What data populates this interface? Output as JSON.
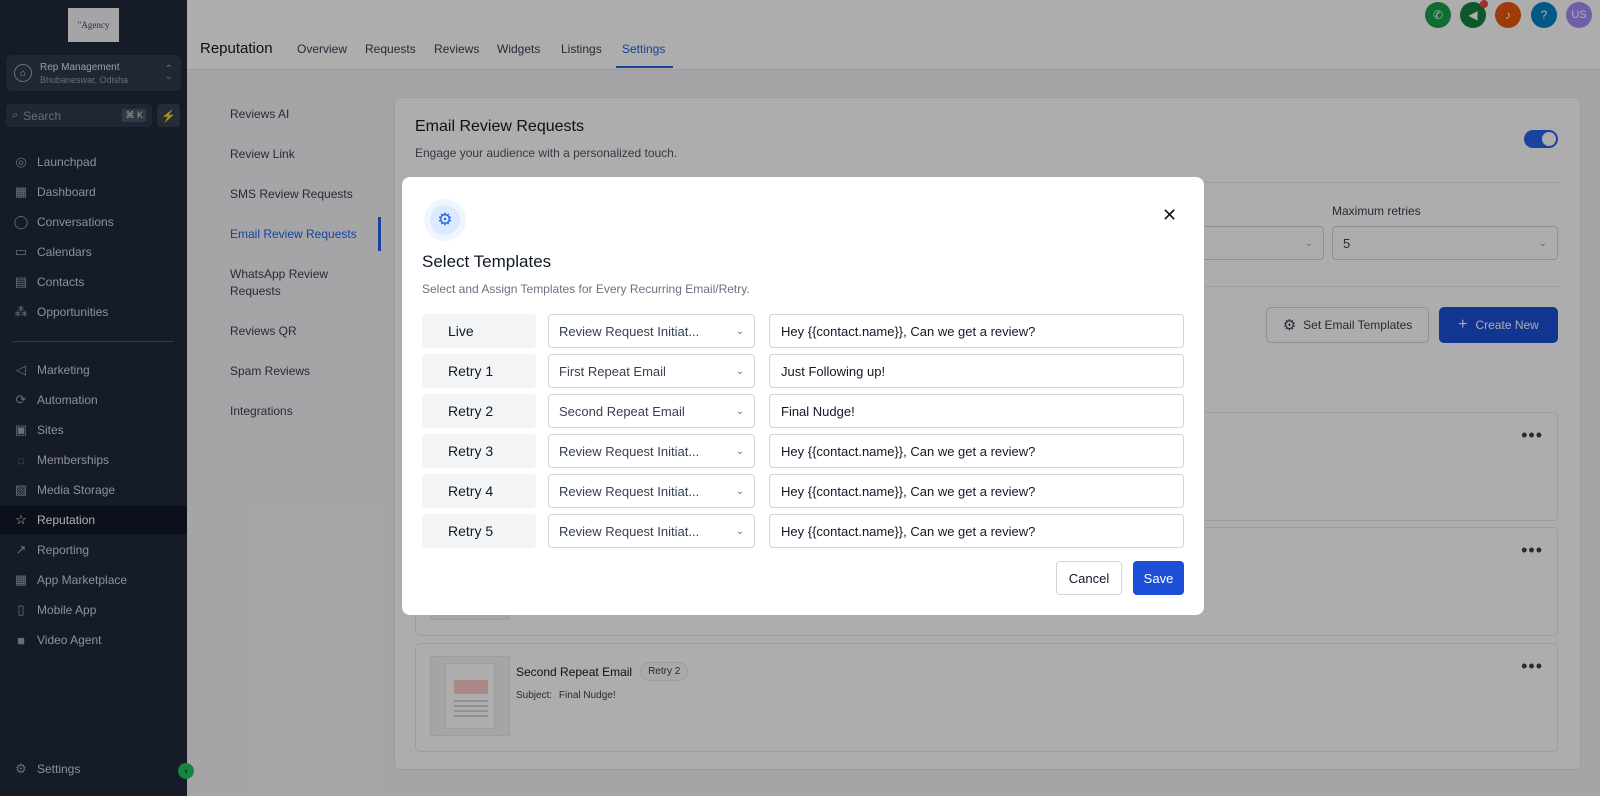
{
  "sidebar": {
    "logo": "\"Agency",
    "location": {
      "name": "Rep Management",
      "sub": "Bhubaneswar, Odisha"
    },
    "search": {
      "placeholder": "Search",
      "shortcut": "⌘ K"
    },
    "items": [
      {
        "label": "Launchpad",
        "icon": "rocket-icon"
      },
      {
        "label": "Dashboard",
        "icon": "dashboard-icon"
      },
      {
        "label": "Conversations",
        "icon": "chat-icon"
      },
      {
        "label": "Calendars",
        "icon": "calendar-icon"
      },
      {
        "label": "Contacts",
        "icon": "contacts-icon"
      },
      {
        "label": "Opportunities",
        "icon": "opportunities-icon"
      },
      {
        "label": "Marketing",
        "icon": "megaphone-icon"
      },
      {
        "label": "Automation",
        "icon": "automation-icon"
      },
      {
        "label": "Sites",
        "icon": "sites-icon"
      },
      {
        "label": "Memberships",
        "icon": "memberships-icon"
      },
      {
        "label": "Media Storage",
        "icon": "media-icon"
      },
      {
        "label": "Reputation",
        "icon": "star-icon"
      },
      {
        "label": "Reporting",
        "icon": "chart-icon"
      },
      {
        "label": "App Marketplace",
        "icon": "apps-icon"
      },
      {
        "label": "Mobile App",
        "icon": "mobile-icon"
      },
      {
        "label": "Video Agent",
        "icon": "video-icon"
      }
    ],
    "settings": "Settings"
  },
  "header": {
    "title": "Reputation",
    "tabs": [
      "Overview",
      "Requests",
      "Reviews",
      "Widgets",
      "Listings",
      "Settings"
    ],
    "avatar": "US"
  },
  "subnav": [
    "Reviews AI",
    "Review Link",
    "SMS Review Requests",
    "Email Review Requests",
    "WhatsApp Review",
    "Requests",
    "Reviews QR",
    "Spam Reviews",
    "Integrations"
  ],
  "card": {
    "title": "Email Review Requests",
    "subtitle": "Engage your audience with a personalized touch.",
    "max_retries_label": "Maximum retries",
    "max_retries_value": "5",
    "set_templates": "Set Email Templates",
    "create_new": "Create New",
    "row3": {
      "name": "Second Repeat Email",
      "badge": "Retry 2",
      "subject_label": "Subject:",
      "subject": "Final Nudge!"
    }
  },
  "modal": {
    "title": "Select Templates",
    "subtitle": "Select and Assign Templates for Every Recurring Email/Retry.",
    "rows": [
      {
        "label": "Live",
        "template": "Review Request Initiat...",
        "subject": "Hey {{contact.name}}, Can we get a review?"
      },
      {
        "label": "Retry 1",
        "template": "First Repeat Email",
        "subject": "Just Following up!"
      },
      {
        "label": "Retry 2",
        "template": "Second Repeat Email",
        "subject": "Final Nudge!"
      },
      {
        "label": "Retry 3",
        "template": "Review Request Initiat...",
        "subject": "Hey {{contact.name}}, Can we get a review?"
      },
      {
        "label": "Retry 4",
        "template": "Review Request Initiat...",
        "subject": "Hey {{contact.name}}, Can we get a review?"
      },
      {
        "label": "Retry 5",
        "template": "Review Request Initiat...",
        "subject": "Hey {{contact.name}}, Can we get a review?"
      }
    ],
    "cancel": "Cancel",
    "save": "Save"
  },
  "colors": {
    "sidebar": "#1f2a3c",
    "accent": "#2563eb",
    "primary_button": "#1d4ed8"
  }
}
